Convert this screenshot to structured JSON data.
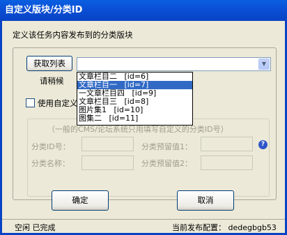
{
  "window": {
    "title": "自定义版块/分类ID"
  },
  "description": "定义该任务内容发布到的分类版块",
  "fetch_button": "获取列表",
  "wait_label": "请稍候",
  "dropdown": {
    "selected_value": "",
    "items": [
      {
        "label": "文章栏目二   [id=6]",
        "selected": false
      },
      {
        "label": "文章栏目一   [id=7]",
        "selected": true
      },
      {
        "label": "一文章栏目四   [id=9]",
        "selected": false
      },
      {
        "label": "文章栏目三   [id=8]",
        "selected": false
      },
      {
        "label": "图片集1   [id=10]",
        "selected": false
      },
      {
        "label": "图集二   [id=11]",
        "selected": false
      }
    ]
  },
  "custom_checkbox": {
    "label": "使用自定义",
    "checked": false
  },
  "custom_group": {
    "legend": "（一般的CMS/论坛系统只用填写自定义的分类ID号）",
    "category_id_label": "分类ID号：",
    "category_id_value": "",
    "reserved1_label": "分类预留值1：",
    "reserved1_value": "",
    "category_name_label": "分类名称：",
    "category_name_value": "",
    "reserved2_label": "分类预留值2：",
    "reserved2_value": ""
  },
  "ok_button": "确定",
  "cancel_button": "取消",
  "status": {
    "left": "空闲 已完成",
    "right": "当前发布配置： dedegbgb53"
  },
  "colors": {
    "titlebar": "#0a4fd6",
    "selection": "#316ac5",
    "background": "#ece9d8"
  },
  "icons": {
    "help": "help-icon",
    "dropdown_arrow": "chevron-down-icon"
  }
}
